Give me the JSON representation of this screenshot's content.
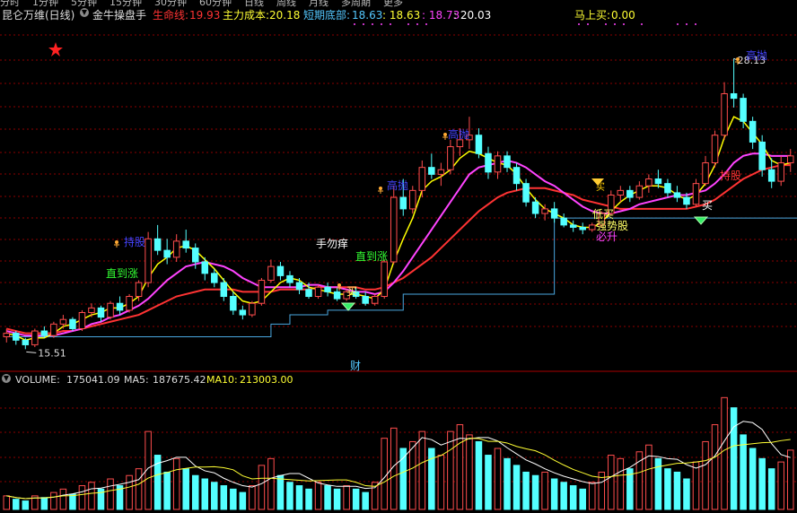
{
  "top_tabs": [
    "分时",
    "1分钟",
    "5分钟",
    "15分钟",
    "30分钟",
    "60分钟",
    "日线",
    "周线",
    "月线",
    "多周期",
    "更多"
  ],
  "header": {
    "stock_name": "昆仑万维(日线)",
    "indicator": "金牛操盘手",
    "life_line_label": "生命线:",
    "life_line_value": "19.93",
    "main_cost_label": "主力成本:",
    "main_cost_value": "20.18",
    "short_bottom_label": "短期底部:",
    "short_bottom_value": "18.63",
    "value_a": ": 18.63",
    "value_b": ": 18.73",
    "value_c": ": 20.03",
    "buy_now_label": "马上买:",
    "buy_now_value": "0.00"
  },
  "volume_header": {
    "volume_label": "VOLUME:",
    "volume_value": "175041.09",
    "ma5_label": "MA5:",
    "ma5_value": "187675.42",
    "ma10_label": "MA10:",
    "ma10_value": "213003.00"
  },
  "colors": {
    "up": "#ff4d4d",
    "down": "#54ffff",
    "ma_short": "#ffff00",
    "ma_mid": "#ff44ff",
    "ma_long": "#ff3333",
    "stair": "#4aa8e0",
    "grid": "#8b0000"
  },
  "chart_data": {
    "type": "candlestick",
    "price_range": [
      14.9,
      29.5
    ],
    "high_label": "28.13",
    "low_label": "15.51",
    "candles": [
      [
        16.05,
        16.4,
        15.8,
        16.2
      ],
      [
        16.2,
        16.3,
        15.7,
        15.9
      ],
      [
        15.9,
        16.0,
        15.51,
        15.7
      ],
      [
        15.7,
        16.4,
        15.6,
        16.3
      ],
      [
        16.3,
        16.5,
        16.0,
        16.1
      ],
      [
        16.1,
        16.7,
        16.0,
        16.6
      ],
      [
        16.6,
        17.0,
        16.4,
        16.8
      ],
      [
        16.8,
        16.9,
        16.3,
        16.4
      ],
      [
        16.4,
        17.2,
        16.3,
        17.1
      ],
      [
        17.1,
        17.5,
        16.9,
        17.3
      ],
      [
        17.3,
        17.4,
        16.7,
        16.9
      ],
      [
        16.9,
        17.6,
        16.8,
        17.5
      ],
      [
        17.5,
        17.8,
        17.0,
        17.2
      ],
      [
        17.2,
        17.9,
        17.1,
        17.8
      ],
      [
        17.8,
        18.5,
        17.6,
        18.4
      ],
      [
        18.4,
        20.6,
        18.2,
        20.3
      ],
      [
        20.3,
        20.9,
        19.6,
        19.8
      ],
      [
        19.8,
        20.3,
        19.2,
        19.5
      ],
      [
        19.5,
        20.5,
        19.3,
        20.2
      ],
      [
        20.2,
        20.7,
        19.7,
        19.9
      ],
      [
        19.9,
        20.1,
        19.0,
        19.3
      ],
      [
        19.3,
        19.5,
        18.5,
        18.8
      ],
      [
        18.8,
        19.0,
        18.2,
        18.4
      ],
      [
        18.4,
        18.6,
        17.6,
        17.8
      ],
      [
        17.8,
        18.0,
        17.0,
        17.2
      ],
      [
        17.2,
        17.4,
        16.8,
        17.0
      ],
      [
        17.0,
        17.6,
        16.9,
        17.5
      ],
      [
        17.5,
        18.6,
        17.4,
        18.5
      ],
      [
        18.5,
        19.4,
        18.4,
        19.1
      ],
      [
        19.1,
        19.3,
        18.5,
        18.7
      ],
      [
        18.7,
        18.9,
        18.2,
        18.4
      ],
      [
        18.4,
        18.6,
        17.9,
        18.1
      ],
      [
        18.1,
        18.4,
        17.7,
        17.8
      ],
      [
        17.8,
        18.3,
        17.7,
        18.2
      ],
      [
        18.2,
        18.4,
        17.8,
        18.0
      ],
      [
        18.0,
        18.2,
        17.6,
        17.7
      ],
      [
        17.7,
        18.1,
        17.6,
        18.0
      ],
      [
        18.0,
        18.2,
        17.7,
        17.8
      ],
      [
        17.8,
        18.0,
        17.4,
        17.5
      ],
      [
        17.5,
        17.9,
        17.4,
        17.8
      ],
      [
        17.8,
        19.4,
        17.7,
        19.3
      ],
      [
        19.3,
        22.6,
        19.2,
        22.1
      ],
      [
        22.1,
        22.9,
        21.3,
        21.6
      ],
      [
        21.6,
        22.6,
        21.4,
        22.4
      ],
      [
        22.4,
        23.7,
        22.1,
        23.4
      ],
      [
        23.4,
        24.0,
        22.9,
        23.1
      ],
      [
        23.1,
        23.6,
        22.6,
        23.3
      ],
      [
        23.3,
        24.6,
        23.1,
        24.3
      ],
      [
        24.3,
        25.1,
        23.9,
        24.6
      ],
      [
        24.6,
        25.6,
        24.2,
        24.8
      ],
      [
        24.8,
        25.1,
        23.8,
        24.0
      ],
      [
        24.0,
        24.3,
        22.9,
        23.2
      ],
      [
        23.2,
        24.1,
        22.9,
        23.9
      ],
      [
        23.9,
        24.1,
        23.2,
        23.4
      ],
      [
        23.4,
        23.6,
        22.4,
        22.7
      ],
      [
        22.7,
        22.9,
        21.7,
        21.9
      ],
      [
        21.9,
        22.1,
        21.2,
        21.4
      ],
      [
        21.4,
        21.8,
        21.1,
        21.6
      ],
      [
        21.6,
        21.9,
        21.0,
        21.2
      ],
      [
        21.2,
        21.4,
        20.8,
        20.9
      ],
      [
        20.9,
        21.1,
        20.6,
        20.8
      ],
      [
        20.8,
        21.0,
        20.5,
        20.7
      ],
      [
        20.7,
        21.0,
        20.6,
        20.9
      ],
      [
        20.9,
        21.5,
        20.8,
        21.4
      ],
      [
        21.4,
        22.4,
        21.3,
        22.2
      ],
      [
        22.2,
        22.6,
        21.9,
        22.4
      ],
      [
        22.4,
        22.6,
        21.9,
        22.1
      ],
      [
        22.1,
        22.8,
        22.0,
        22.6
      ],
      [
        22.6,
        23.1,
        22.3,
        22.9
      ],
      [
        22.9,
        23.3,
        22.5,
        22.7
      ],
      [
        22.7,
        22.9,
        22.1,
        22.3
      ],
      [
        22.3,
        22.6,
        21.9,
        22.1
      ],
      [
        22.1,
        22.3,
        21.6,
        21.8
      ],
      [
        21.8,
        22.9,
        21.7,
        22.7
      ],
      [
        22.7,
        23.9,
        22.6,
        23.6
      ],
      [
        23.6,
        25.0,
        23.4,
        24.8
      ],
      [
        24.8,
        27.1,
        24.6,
        26.6
      ],
      [
        26.6,
        28.13,
        26.0,
        26.4
      ],
      [
        26.4,
        26.6,
        25.1,
        25.4
      ],
      [
        25.4,
        25.6,
        24.2,
        24.5
      ],
      [
        24.5,
        24.8,
        23.0,
        23.3
      ],
      [
        23.3,
        23.8,
        22.5,
        22.8
      ],
      [
        22.8,
        23.9,
        22.6,
        23.6
      ],
      [
        23.6,
        24.2,
        23.2,
        23.9
      ]
    ],
    "ma_short": [
      16.2,
      16.1,
      15.9,
      16.0,
      16.0,
      16.2,
      16.5,
      16.6,
      16.8,
      17.0,
      17.1,
      17.3,
      17.3,
      17.5,
      17.8,
      18.6,
      19.2,
      19.5,
      19.9,
      20.0,
      19.8,
      19.4,
      19.0,
      18.5,
      18.0,
      17.6,
      17.5,
      17.6,
      18.0,
      18.4,
      18.6,
      18.5,
      18.2,
      18.1,
      18.0,
      17.9,
      17.9,
      17.9,
      17.8,
      17.7,
      18.1,
      19.3,
      20.3,
      21.2,
      22.4,
      22.8,
      23.0,
      23.3,
      23.8,
      24.1,
      24.0,
      23.8,
      23.6,
      23.5,
      23.1,
      22.5,
      22.0,
      21.6,
      21.4,
      21.2,
      20.9,
      20.8,
      20.8,
      21.0,
      21.5,
      21.9,
      22.2,
      22.4,
      22.6,
      22.6,
      22.5,
      22.2,
      22.0,
      22.2,
      22.7,
      23.5,
      24.7,
      25.6,
      25.4,
      24.9,
      24.4,
      23.7,
      23.5,
      23.6
    ],
    "ma_mid": [
      16.3,
      16.2,
      16.1,
      16.1,
      16.1,
      16.1,
      16.2,
      16.3,
      16.4,
      16.6,
      16.7,
      16.9,
      17.0,
      17.2,
      17.4,
      17.7,
      18.1,
      18.5,
      18.8,
      19.1,
      19.2,
      19.3,
      19.2,
      19.1,
      18.9,
      18.6,
      18.4,
      18.2,
      18.2,
      18.2,
      18.2,
      18.2,
      18.3,
      18.3,
      18.2,
      18.2,
      18.1,
      18.0,
      18.0,
      17.9,
      18.0,
      18.4,
      18.9,
      19.5,
      20.1,
      20.7,
      21.3,
      21.9,
      22.5,
      23.1,
      23.4,
      23.5,
      23.6,
      23.7,
      23.6,
      23.4,
      23.1,
      22.8,
      22.6,
      22.3,
      22.0,
      21.7,
      21.5,
      21.4,
      21.4,
      21.5,
      21.6,
      21.8,
      21.9,
      22.0,
      22.1,
      22.2,
      22.2,
      22.3,
      22.4,
      22.7,
      23.1,
      23.6,
      23.9,
      24.0,
      24.0,
      23.9,
      23.9,
      23.9
    ],
    "ma_long": [
      16.4,
      16.3,
      16.2,
      16.2,
      16.2,
      16.2,
      16.3,
      16.3,
      16.4,
      16.5,
      16.6,
      16.7,
      16.8,
      16.9,
      17.0,
      17.2,
      17.4,
      17.6,
      17.8,
      17.9,
      18.0,
      18.1,
      18.1,
      18.1,
      18.1,
      18.0,
      18.0,
      18.0,
      18.0,
      18.1,
      18.1,
      18.1,
      18.1,
      18.2,
      18.2,
      18.2,
      18.2,
      18.2,
      18.1,
      18.1,
      18.2,
      18.4,
      18.6,
      18.9,
      19.2,
      19.5,
      19.9,
      20.3,
      20.7,
      21.1,
      21.5,
      21.8,
      22.1,
      22.3,
      22.4,
      22.5,
      22.5,
      22.5,
      22.4,
      22.3,
      22.2,
      22.0,
      21.9,
      21.8,
      21.7,
      21.6,
      21.6,
      21.6,
      21.6,
      21.6,
      21.6,
      21.6,
      21.6,
      21.7,
      21.8,
      22.0,
      22.3,
      22.6,
      22.9,
      23.1,
      23.3,
      23.4,
      23.5,
      23.5
    ],
    "support_steps": [
      [
        0,
        16.05
      ],
      [
        27,
        16.05
      ],
      [
        28,
        16.6
      ],
      [
        30,
        17.0
      ],
      [
        34,
        17.2
      ],
      [
        42,
        17.9
      ],
      [
        53,
        17.9
      ],
      [
        54,
        17.9
      ],
      [
        57,
        17.9
      ],
      [
        58,
        21.2
      ],
      [
        84,
        21.2
      ]
    ],
    "volume_range": [
      0,
      360000
    ],
    "volume": [
      40,
      30,
      25,
      40,
      35,
      50,
      60,
      45,
      70,
      80,
      60,
      90,
      70,
      100,
      120,
      230,
      160,
      110,
      150,
      120,
      100,
      90,
      80,
      70,
      60,
      50,
      70,
      130,
      150,
      100,
      80,
      70,
      60,
      80,
      70,
      60,
      70,
      60,
      50,
      80,
      210,
      240,
      180,
      200,
      230,
      180,
      160,
      230,
      250,
      220,
      200,
      160,
      180,
      150,
      130,
      110,
      100,
      110,
      90,
      80,
      70,
      60,
      80,
      110,
      160,
      150,
      120,
      170,
      190,
      150,
      120,
      110,
      90,
      140,
      200,
      250,
      330,
      300,
      220,
      180,
      150,
      120,
      140,
      175
    ]
  },
  "annotations": {
    "hand_tag": "手勿痒",
    "rise_tag_1": "直到涨",
    "rise_tag_2": "直到涨",
    "buy_tag_1": "买",
    "buy_tag_2": "买",
    "buy_tag_3": "买",
    "low_buy_tag": "低买",
    "strong_stock_tag": "强势股",
    "rise_tag_3": "必升",
    "sell_tag_1": "高抛",
    "sell_tag_2": "高抛",
    "sell_tag_3": "高抛",
    "hold_tag_1": "持股",
    "hold_tag_2": "持股",
    "finance_tag": "财"
  }
}
